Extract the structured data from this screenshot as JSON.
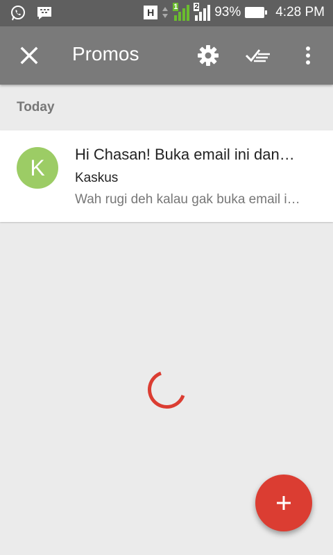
{
  "status_bar": {
    "network_type": "H",
    "sim1_label": "1",
    "sim2_label": "2",
    "battery_percent": "93%",
    "time": "4:28 PM",
    "icons": [
      "whatsapp-icon",
      "bbm-icon",
      "signal-icon",
      "battery-icon"
    ]
  },
  "toolbar": {
    "title": "Promos",
    "icons": [
      "close-icon",
      "settings-gear-icon",
      "mark-all-read-icon",
      "more-vert-icon"
    ]
  },
  "section": {
    "header": "Today"
  },
  "mail": {
    "avatar_letter": "K",
    "subject": "Hi Chasan! Buka email ini dan…",
    "sender": "Kaskus",
    "snippet": "Wah rugi deh kalau gak buka email i…"
  },
  "colors": {
    "status_bar": "#5f5f5f",
    "toolbar": "#7a7a7a",
    "background": "#ebebeb",
    "avatar": "#9ccc65",
    "accent": "#db3d32",
    "sim1_signal": "#6bbd2e"
  },
  "fab": {
    "icon": "plus-icon"
  }
}
